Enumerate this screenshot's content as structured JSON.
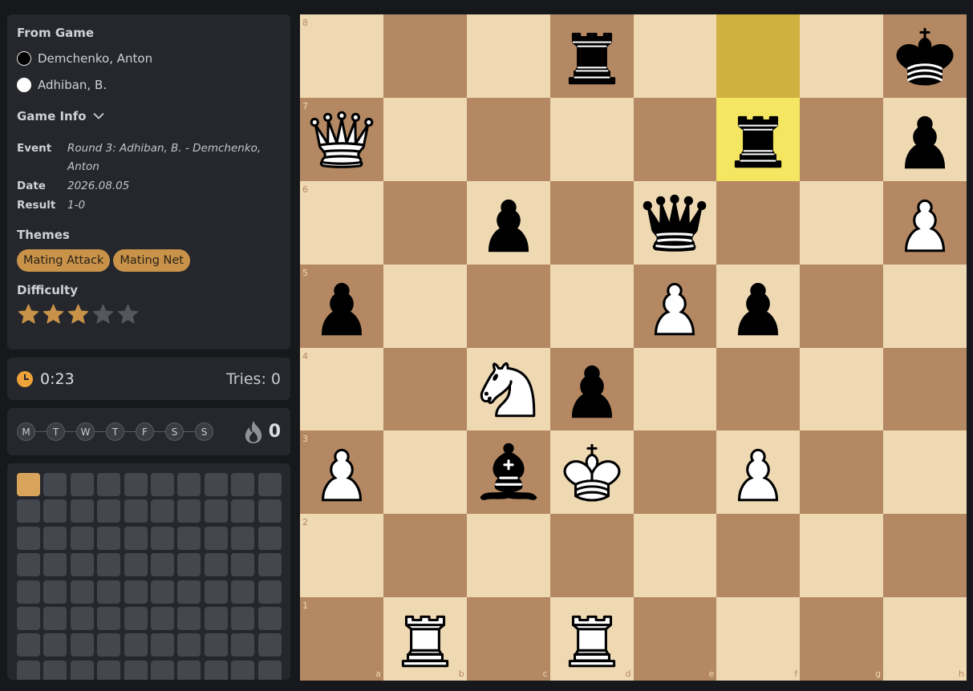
{
  "info": {
    "from_game_title": "From Game",
    "players": [
      {
        "name": "Demchenko, Anton",
        "color": "black"
      },
      {
        "name": "Adhiban, B.",
        "color": "white"
      }
    ],
    "game_info_title": "Game Info",
    "meta": [
      {
        "key": "Event",
        "value": "Round 3: Adhiban, B. - Demchenko, Anton"
      },
      {
        "key": "Date",
        "value": "2026.08.05"
      },
      {
        "key": "Result",
        "value": "1-0"
      }
    ],
    "themes_title": "Themes",
    "themes": [
      "Mating Attack",
      "Mating Net"
    ],
    "difficulty_title": "Difficulty",
    "difficulty": 3,
    "difficulty_max": 5
  },
  "timer": {
    "elapsed": "0:23",
    "tries_label": "Tries: 0",
    "icon": "clock-icon"
  },
  "week": {
    "days": [
      "M",
      "T",
      "W",
      "T",
      "F",
      "S",
      "S"
    ],
    "streak": "0",
    "icon": "flame-icon"
  },
  "progress": {
    "completed": 1,
    "visible_cells": 80
  },
  "board": {
    "orientation": "white",
    "files": [
      "a",
      "b",
      "c",
      "d",
      "e",
      "f",
      "g",
      "h"
    ],
    "ranks": [
      "8",
      "7",
      "6",
      "5",
      "4",
      "3",
      "2",
      "1"
    ],
    "last_move": {
      "from": "f8",
      "to": "f7"
    },
    "pieces": [
      {
        "square": "d8",
        "type": "rook",
        "color": "black"
      },
      {
        "square": "h8",
        "type": "king",
        "color": "black"
      },
      {
        "square": "a7",
        "type": "queen",
        "color": "white"
      },
      {
        "square": "f7",
        "type": "rook",
        "color": "black"
      },
      {
        "square": "h7",
        "type": "pawn",
        "color": "black"
      },
      {
        "square": "c6",
        "type": "pawn",
        "color": "black"
      },
      {
        "square": "e6",
        "type": "queen",
        "color": "black"
      },
      {
        "square": "h6",
        "type": "pawn",
        "color": "white"
      },
      {
        "square": "a5",
        "type": "pawn",
        "color": "black"
      },
      {
        "square": "e5",
        "type": "pawn",
        "color": "white"
      },
      {
        "square": "f5",
        "type": "pawn",
        "color": "black"
      },
      {
        "square": "c4",
        "type": "knight",
        "color": "white"
      },
      {
        "square": "d4",
        "type": "pawn",
        "color": "black"
      },
      {
        "square": "a3",
        "type": "pawn",
        "color": "white"
      },
      {
        "square": "c3",
        "type": "bishop",
        "color": "black"
      },
      {
        "square": "d3",
        "type": "king",
        "color": "white"
      },
      {
        "square": "f3",
        "type": "pawn",
        "color": "white"
      },
      {
        "square": "b1",
        "type": "rook",
        "color": "white"
      },
      {
        "square": "d1",
        "type": "rook",
        "color": "white"
      }
    ]
  },
  "colors": {
    "light_square": "#efd9b3",
    "dark_square": "#b38863",
    "last_move_from": "#cfb040",
    "last_move_to": "#f4e661",
    "accent": "#c89249",
    "star_filled": "#c89249",
    "star_empty": "#55575e"
  }
}
